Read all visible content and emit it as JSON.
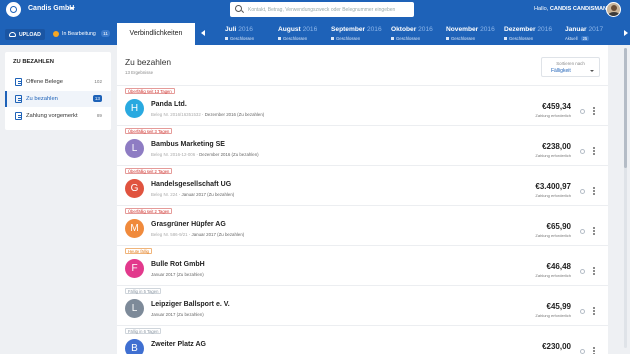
{
  "header": {
    "company": "Candis GmbH",
    "search_placeholder": "Kontakt, Betrag, Verwendungszweck oder Belegnummer eingeben",
    "greeting_prefix": "Hallo,",
    "user_name": "CANDIS CANDISMAN"
  },
  "toolbar": {
    "upload_label": "UPLOAD",
    "processing_label": "In Bearbeitung",
    "processing_count": "11"
  },
  "tabs": {
    "active": "Verbindlichkeiten"
  },
  "months": [
    {
      "name": "Juli",
      "year": "2016",
      "status": "Geschlossen",
      "badge": ""
    },
    {
      "name": "August",
      "year": "2016",
      "status": "Geschlossen",
      "badge": ""
    },
    {
      "name": "September",
      "year": "2016",
      "status": "Geschlossen",
      "badge": ""
    },
    {
      "name": "Oktober",
      "year": "2016",
      "status": "Geschlossen",
      "badge": ""
    },
    {
      "name": "November",
      "year": "2016",
      "status": "Geschlossen",
      "badge": ""
    },
    {
      "name": "Dezember",
      "year": "2016",
      "status": "Geschlossen",
      "badge": ""
    },
    {
      "name": "Januar",
      "year": "2017",
      "status": "Aktuell",
      "badge": "25"
    }
  ],
  "sidebar": {
    "title": "ZU BEZAHLEN",
    "items": [
      {
        "label": "Offene Belege",
        "count": "102",
        "active": false
      },
      {
        "label": "Zu bezahlen",
        "count": "13",
        "active": true
      },
      {
        "label": "Zahlung vorgemerkt",
        "count": "89",
        "active": false
      }
    ]
  },
  "main": {
    "title": "Zu bezahlen",
    "subtitle": "13 Ergebnisse",
    "sort_label": "Sortieren nach",
    "sort_value": "Fälligkeit"
  },
  "rows": [
    {
      "tag": "Überfällig seit 13 Tagen",
      "tag_type": "red",
      "letter": "H",
      "color": "#29a9e0",
      "vendor": "Panda Ltd.",
      "beleg_no": "Beleg Nr. 2016/16351532",
      "date": "Dezember 2016 (Zu bezahlen)",
      "amount": "€459,34",
      "amount_note": "Zahlung erforderlich"
    },
    {
      "tag": "Überfällig seit 3 Tagen",
      "tag_type": "red",
      "letter": "L",
      "color": "#8e7cc3",
      "vendor": "Bambus Marketing SE",
      "beleg_no": "Beleg Nr. 2016-12-006",
      "date": "Dezember 2016 (Zu bezahlen)",
      "amount": "€238,00",
      "amount_note": "Zahlung erforderlich"
    },
    {
      "tag": "Überfällig seit 2 Tagen",
      "tag_type": "red",
      "letter": "G",
      "color": "#e0533f",
      "vendor": "Handelsgesellschaft UG",
      "beleg_no": "Beleg Nr. 224",
      "date": "Januar 2017 (Zu bezahlen)",
      "amount": "€3.400,97",
      "amount_note": "Zahlung erforderlich"
    },
    {
      "tag": "Überfällig seit 2 Tagen",
      "tag_type": "red",
      "letter": "M",
      "color": "#f08a3c",
      "vendor": "Grasgrüner Hüpfer AG",
      "beleg_no": "Beleg Nr. 586-9/21",
      "date": "Januar 2017 (Zu bezahlen)",
      "amount": "€65,90",
      "amount_note": "Zahlung erforderlich"
    },
    {
      "tag": "Heute fällig",
      "tag_type": "orange",
      "letter": "F",
      "color": "#e2398c",
      "vendor": "Bulle Rot GmbH",
      "beleg_no": "",
      "date": "Januar 2017 (Zu bezahlen)",
      "amount": "€46,48",
      "amount_note": "Zahlung erforderlich"
    },
    {
      "tag": "Fällig in 5 Tagen",
      "tag_type": "gray",
      "letter": "L",
      "color": "#7d8a99",
      "vendor": "Leipziger Ballsport e. V.",
      "beleg_no": "",
      "date": "Januar 2017 (Zu bezahlen)",
      "amount": "€45,99",
      "amount_note": "Zahlung erforderlich"
    },
    {
      "tag": "Fällig in 6 Tagen",
      "tag_type": "gray",
      "letter": "B",
      "color": "#3f6fd1",
      "vendor": "Zweiter Platz AG",
      "beleg_no": "",
      "date": "",
      "amount": "€230,00",
      "amount_note": ""
    }
  ]
}
